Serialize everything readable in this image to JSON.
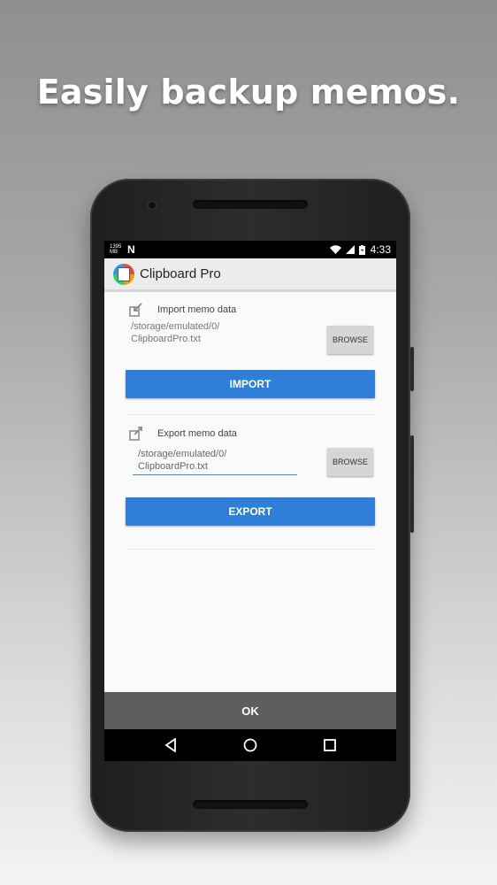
{
  "headline": "Easily backup memos.",
  "status_bar": {
    "speed": "1395 MB",
    "n_icon": "N",
    "wifi_icon": "wifi-icon",
    "signal_icon": "signal-icon",
    "battery_icon": "battery-icon",
    "time": "4:33"
  },
  "app_bar": {
    "icon": "clipboard-pro-app-icon",
    "title": "Clipboard Pro"
  },
  "import_section": {
    "icon": "import-icon",
    "label": "Import memo data",
    "path_line1": "/storage/emulated/0/",
    "path_line2": "ClipboardPro.txt",
    "browse_label": "BROWSE",
    "action_label": "IMPORT"
  },
  "export_section": {
    "icon": "export-icon",
    "label": "Export memo data",
    "path_line1": "/storage/emulated/0/",
    "path_line2": "ClipboardPro.txt",
    "browse_label": "BROWSE",
    "action_label": "EXPORT"
  },
  "ok_label": "OK",
  "nav": {
    "back_icon": "back-icon",
    "home_icon": "home-icon",
    "recents_icon": "recents-icon"
  },
  "colors": {
    "primary_button": "#2f7fd8",
    "ok_bar": "#5e5e5e",
    "app_bar": "#ececec"
  }
}
